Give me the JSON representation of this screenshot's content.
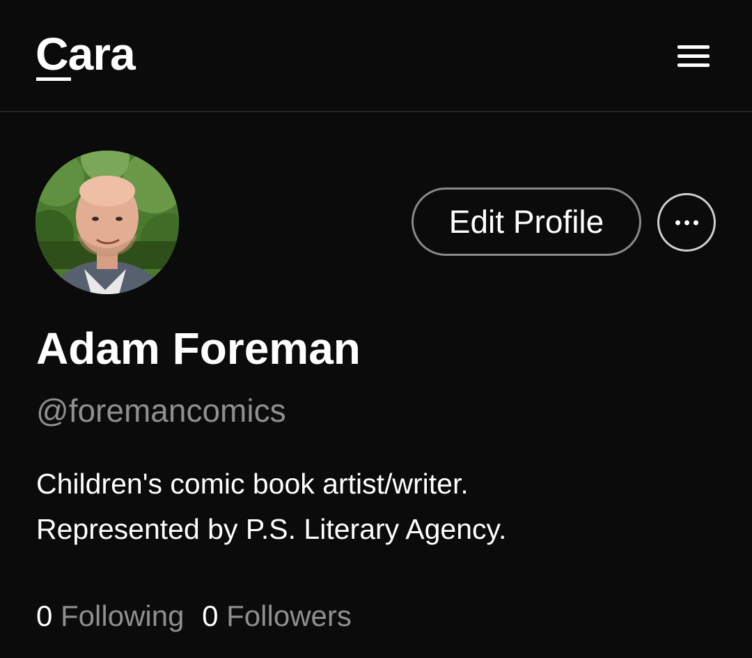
{
  "header": {
    "logo_text": "Cara",
    "menu_icon": "hamburger-menu-icon"
  },
  "profile": {
    "avatar_alt": "profile-photo",
    "edit_button_label": "Edit Profile",
    "more_icon": "more-horizontal-icon",
    "display_name": "Adam Foreman",
    "handle": "@foremancomics",
    "bio_lines": [
      "Children's comic book artist/writer.",
      "Represented by P.S. Literary Agency."
    ],
    "stats": {
      "following_count": "0",
      "following_label": "Following",
      "followers_count": "0",
      "followers_label": "Followers"
    }
  },
  "colors": {
    "background": "#0b0b0b",
    "text_primary": "#ffffff",
    "text_secondary": "#8f8f8f",
    "border": "#8a8a8a"
  }
}
